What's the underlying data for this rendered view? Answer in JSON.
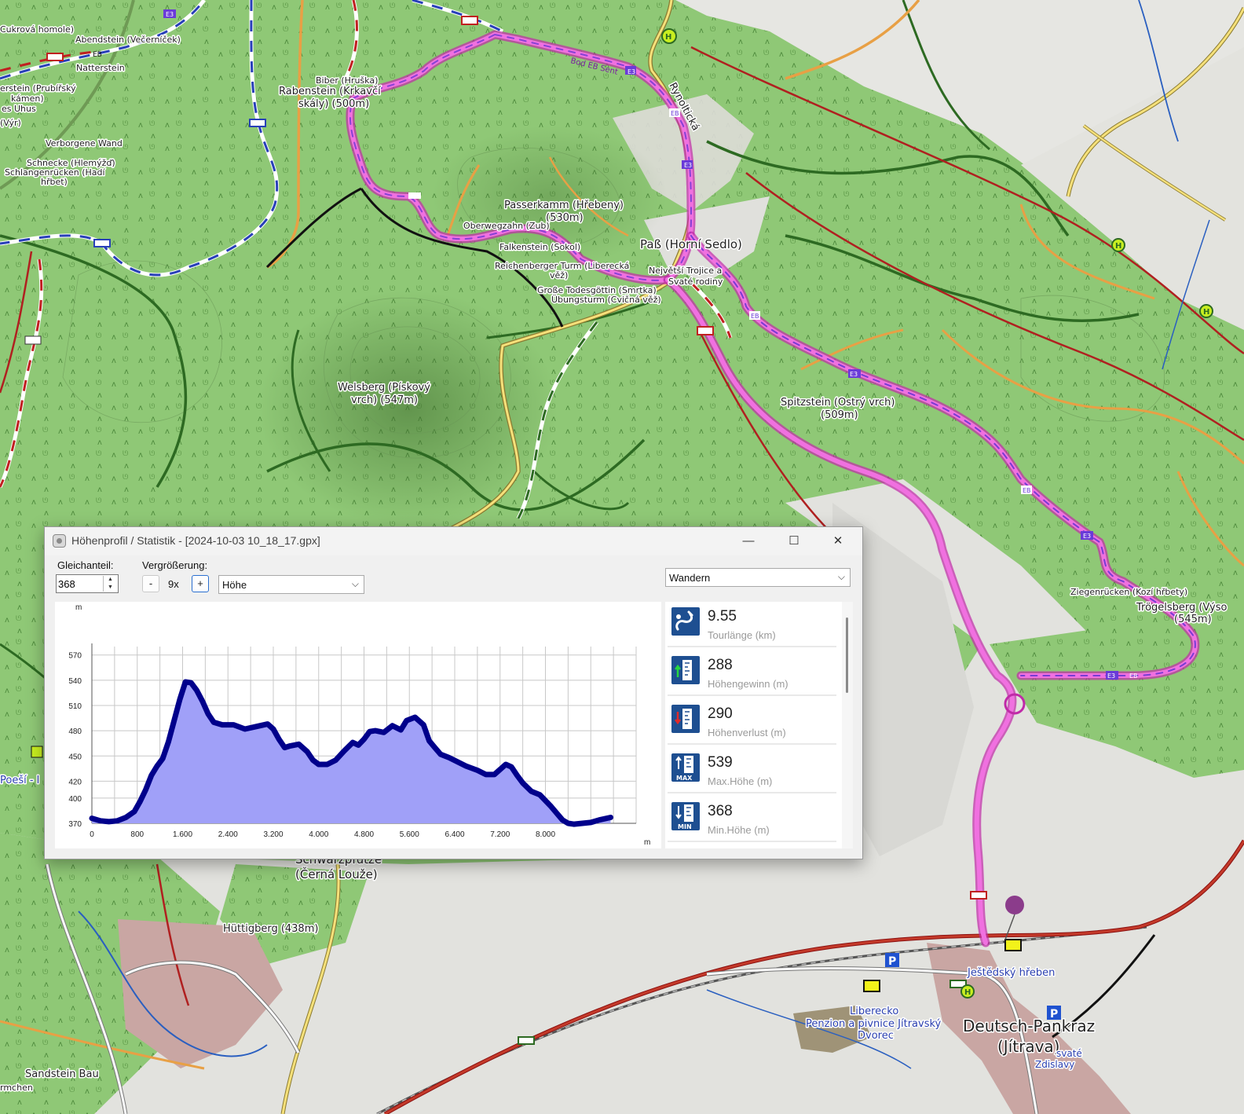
{
  "map": {
    "labels": {
      "rabenstein": "Rabenstein (Krkavčí",
      "rabenstein2": "skály) (500m)",
      "biber": "Biber (Hruška)",
      "abendstein": "Abendstein (Večerníček)",
      "natterstein": "Natterstein",
      "zuckerova": "Cukrová homole)",
      "prubirsky": "erstein (Prubířský",
      "prubirsky2": "kámen)",
      "uhus": "es Uhus",
      "vyr": "(Výr)",
      "verborgene": "Verborgene Wand",
      "schnecke": "Schnecke (Hlemýžď)",
      "schlangen": "Schlangenrücken (Hadí",
      "schlangen2": "hřbet)",
      "passerkamm": "Passerkamm (Hřebeny)",
      "passerkamm2": "(530m)",
      "oberwegzahn": "Oberwegzahn (Zub)",
      "falkenstein": "Falkenstein (Sokol)",
      "reichenberger": "Reichenberger Turm (Liberecká",
      "reichenberger2": "věž)",
      "todesgottin": "Große Todesgöttin (Smrtka)",
      "ubungsturm": "Übungsturm (Cvičná věž)",
      "pass": "Paß (Horní Sedlo)",
      "trojice": "Největší Trojice a",
      "trojice2": "Svaté rodiny",
      "rynoltice": "Rynoltická",
      "welsberg": "Welsberg (Pískový",
      "welsberg2": "vrch) (547m)",
      "spitzstein": "Spitzstein (Ostrý vrch)",
      "spitzstein2": "(509m)",
      "ziegenrucken": "Ziegenrücken (Kozí hřbety)",
      "trogelsberg": "Trögelsberg (Výso",
      "trogelsberg2": "(545m)",
      "schwarzpfutze": "Schwarzpfütze",
      "cerna": "(Černá Louže)",
      "huttigberg": "Hüttigberg (438m)",
      "sandstein": "Sandstein Bau",
      "rmchen": "rmchen",
      "poesi": "Poeší - l",
      "liberecko": "Liberecko",
      "penzion": "Penzion a pivnice Jítravský",
      "dvorec": "Dvorec",
      "jestedsky": "Ještědský hřeben",
      "deutsch": "Deutsch-Pankraz",
      "jitrava": "(Jítrava)",
      "zdislavy": "Zdislavy",
      "svate": "svaté",
      "e3": "E3",
      "eb": "EB",
      "h": "H",
      "p": "P",
      "bodenweg": "Bod EB Sent"
    }
  },
  "dialog": {
    "title": "Höhenprofil / Statistik - [2024-10-03 10_18_17.gpx]",
    "min_glyph": "—",
    "max_glyph": "☐",
    "close_glyph": "✕",
    "gleichanteil_label": "Gleichanteil:",
    "gleichanteil_value": "368",
    "spin_up": "▲",
    "spin_down": "▼",
    "vergroesserung_label": "Vergrößerung:",
    "zoom_minus": "-",
    "zoom_value": "9x",
    "zoom_plus": "+",
    "profile_select": "Höhe",
    "activity_select": "Wandern",
    "chevron": "⌵"
  },
  "stats": [
    {
      "value": "9.55",
      "label": "Tourlänge (km)",
      "icon": "route-icon"
    },
    {
      "value": "288",
      "label": "Höhengewinn (m)",
      "icon": "elevation-gain-icon"
    },
    {
      "value": "290",
      "label": "Höhenverlust (m)",
      "icon": "elevation-loss-icon"
    },
    {
      "value": "539",
      "label": "Max.Höhe (m)",
      "icon": "max-elevation-icon"
    },
    {
      "value": "368",
      "label": "Min.Höhe (m)",
      "icon": "min-elevation-icon"
    }
  ],
  "colors": {
    "fill": "#a0a0f8",
    "line": "#00008b",
    "track": "#e040c8"
  },
  "chart_data": {
    "type": "area",
    "title": "",
    "xlabel": "m",
    "ylabel": "m",
    "xlim": [
      0,
      9600
    ],
    "ylim": [
      370,
      580
    ],
    "x_ticks": [
      0,
      800,
      1600,
      2400,
      3200,
      4000,
      4800,
      5600,
      6400,
      7200,
      8000
    ],
    "x_tick_labels": [
      "0",
      "800",
      "1.600",
      "2.400",
      "3.200",
      "4.000",
      "4.800",
      "5.600",
      "6.400",
      "7.200",
      "8.000"
    ],
    "y_ticks": [
      370,
      400,
      420,
      450,
      480,
      510,
      540,
      570
    ],
    "grid": true,
    "legend": "none",
    "series": [
      {
        "x": [
          0,
          150,
          300,
          450,
          600,
          750,
          850,
          950,
          1050,
          1150,
          1250,
          1350,
          1450,
          1550,
          1650,
          1750,
          1850,
          1950,
          2050,
          2150,
          2300,
          2500,
          2700,
          2900,
          3100,
          3200,
          3300,
          3400,
          3500,
          3650,
          3800,
          3900,
          4000,
          4150,
          4300,
          4450,
          4600,
          4700,
          4800,
          4900,
          5000,
          5150,
          5300,
          5450,
          5550,
          5700,
          5850,
          5950,
          6050,
          6150,
          6300,
          6450,
          6600,
          6800,
          6950,
          7100,
          7200,
          7300,
          7400,
          7500,
          7600,
          7750,
          7900,
          8100,
          8200,
          8300,
          8400,
          8500,
          8650,
          8800,
          8950,
          9150
        ],
        "y": [
          376,
          373,
          372,
          373,
          377,
          384,
          396,
          410,
          427,
          438,
          447,
          467,
          492,
          517,
          538,
          537,
          528,
          515,
          500,
          490,
          487,
          487,
          482,
          485,
          488,
          482,
          470,
          460,
          462,
          464,
          455,
          445,
          440,
          440,
          445,
          456,
          466,
          463,
          470,
          479,
          480,
          478,
          486,
          481,
          492,
          496,
          487,
          468,
          460,
          452,
          448,
          443,
          438,
          433,
          428,
          428,
          434,
          440,
          437,
          427,
          418,
          408,
          404,
          390,
          382,
          374,
          370,
          369,
          370,
          371,
          374,
          377
        ]
      }
    ]
  }
}
